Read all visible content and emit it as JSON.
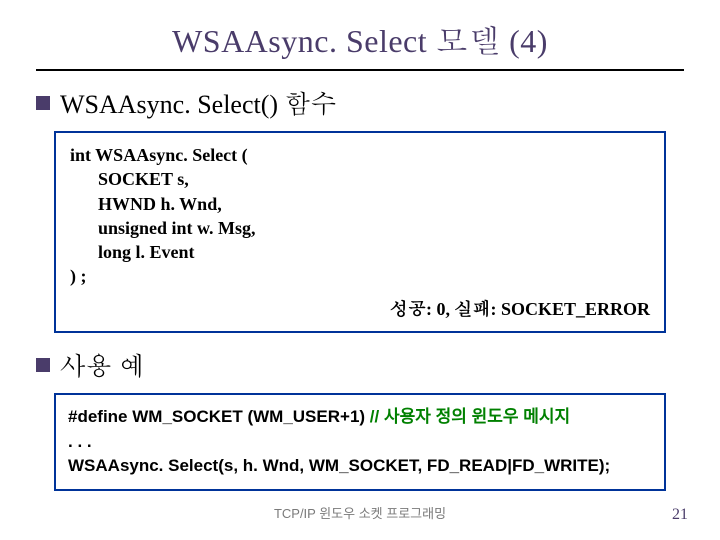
{
  "title": "WSAAsync. Select 모델 (4)",
  "section1": {
    "heading": "WSAAsync. Select() 함수",
    "code": {
      "l1": "int WSAAsync. Select (",
      "p1": "SOCKET s,",
      "p2": "HWND h. Wnd,",
      "p3": "unsigned int w. Msg,",
      "p4": "long l. Event",
      "l2": ") ;",
      "result": "성공: 0, 실패: SOCKET_ERROR"
    }
  },
  "section2": {
    "heading": "사용 예",
    "code": {
      "l1a": "#define WM_SOCKET (WM_USER+1) ",
      "l1b": "// 사용자 정의 윈도우 메시지",
      "l2": ". . .",
      "l3": "WSAAsync. Select(s, h. Wnd, WM_SOCKET, FD_READ|FD_WRITE);"
    }
  },
  "footer": "TCP/IP 윈도우 소켓 프로그래밍",
  "page": "21"
}
